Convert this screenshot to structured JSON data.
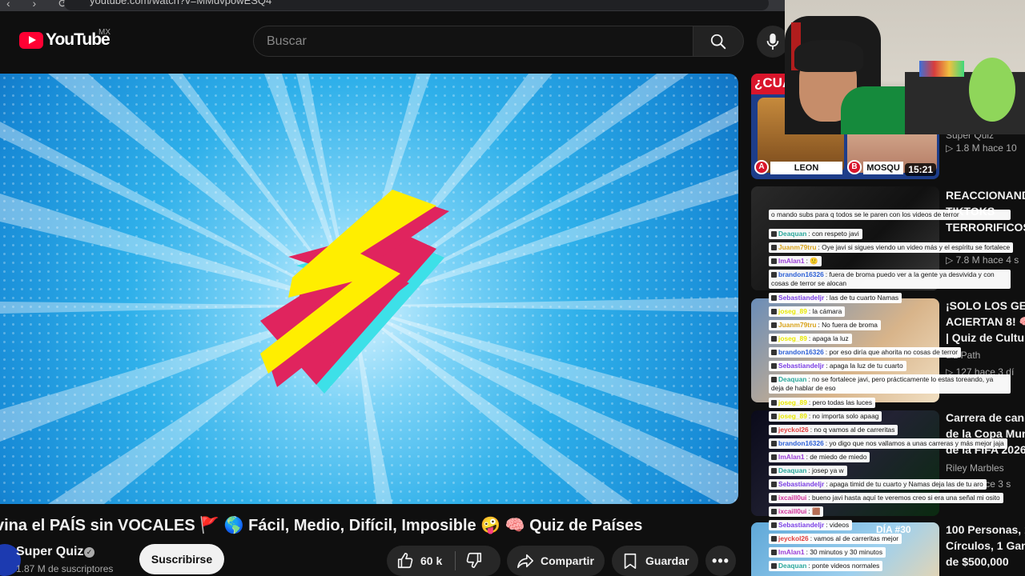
{
  "browser": {
    "url": "youtube.com/watch?v=MMdvpowESQ4",
    "nav_glyphs": "‹ › ⟳"
  },
  "header": {
    "logo_text": "YouTube",
    "country_code": "MX",
    "search_placeholder": "Buscar"
  },
  "video": {
    "title": "vina el PAÍS sin VOCALES 🚩 🌎 Fácil, Medio, Difícil, Imposible 🤪 🧠 Quiz de Países",
    "channel": "Super Quiz",
    "subscribers": "1.87 M de suscriptores",
    "subscribe_label": "Suscribirse",
    "likes": "60 k",
    "share_label": "Compartir",
    "save_label": "Guardar",
    "more_label": "•••"
  },
  "recommendations": [
    {
      "thumb_text": "¿CUA",
      "badge_a": "A",
      "label_a": "LEON",
      "badge_b": "B",
      "label_b": "MOSQU",
      "duration": "15:21",
      "title": "",
      "channel": "Super Quiz",
      "meta": "▷ 1.8 M  hace 10"
    },
    {
      "title": "REACCIONAND\nTIKTOKS\nTERRORIFICOS",
      "channel": "",
      "meta": "▷ 7.8 M  hace 4 s"
    },
    {
      "title": "¡SOLO LOS GEN\nACIERTAN 8! 🧠\n| Quiz de Cultura",
      "channel": "uiz Path",
      "meta": "▷ 127  hace 3 dí"
    },
    {
      "title": "Carrera de canic\nde la Copa Mund\nde la FIFA 2026",
      "channel": "Riley Marbles",
      "meta": "▷ 1 M  hace 3 s"
    },
    {
      "thumb_text": "DÍA #30",
      "title": "100 Personas, 1\nCírculos, 1 Gana\nde $500,000",
      "channel": "",
      "meta": ""
    }
  ],
  "chat": [
    {
      "user": "",
      "color": "#888888",
      "text": "o mando subs para q todos se le paren con los videos de terror",
      "wrap": true
    },
    {
      "user": "Deaquan",
      "color": "#2aa79b",
      "text": ": con respeto javi"
    },
    {
      "user": "Juanm79tru",
      "color": "#d8a21a",
      "text": ": Oye javi si sigues viendo un video más y el espíritu se fortalece"
    },
    {
      "user": "ImAlan1",
      "color": "#9b3fd6",
      "text": ": 🙂"
    },
    {
      "user": "brandon16326",
      "color": "#2b5fd6",
      "text": ": fuera de broma puedo ver a la gente ya desvivida y con cosas de terror se alocan",
      "wrap": true
    },
    {
      "user": "Sebastiandeljr",
      "color": "#7b3fe4",
      "text": ": las de tu cuarto Namas"
    },
    {
      "user": "joseg_89",
      "color": "#e8e800",
      "text": ": la cámara"
    },
    {
      "user": "Juanm79tru",
      "color": "#d8a21a",
      "text": ": No fuera de broma"
    },
    {
      "user": "joseg_89",
      "color": "#e8e800",
      "text": ": apaga la luz"
    },
    {
      "user": "brandon16326",
      "color": "#2b5fd6",
      "text": ": por eso diría que ahorita no cosas de terror"
    },
    {
      "user": "Sebastiandeljr",
      "color": "#7b3fe4",
      "text": ": apaga la luz de tu cuarto"
    },
    {
      "user": "Deaquan",
      "color": "#2aa79b",
      "text": ": no se fortalece javi, pero prácticamente lo estas toreando, ya deja de hablar de eso",
      "wrap": true
    },
    {
      "user": "joseg_89",
      "color": "#e8e800",
      "text": ": pero todas las luces"
    },
    {
      "user": "joseg_89",
      "color": "#e8e800",
      "text": ": no importa solo apaag"
    },
    {
      "user": "jeyckol26",
      "color": "#e03c3c",
      "text": ": no q vamos al de carreritas"
    },
    {
      "user": "brandon16326",
      "color": "#2b5fd6",
      "text": ": yo digo que nos vallamos a unas carreras y más mejor jaja"
    },
    {
      "user": "ImAlan1",
      "color": "#9b3fd6",
      "text": ": de miedo de miedo"
    },
    {
      "user": "Deaquan",
      "color": "#2aa79b",
      "text": ": josep ya w"
    },
    {
      "user": "Sebastiandeljr",
      "color": "#7b3fe4",
      "text": ": apaga timid de tu cuarto y Namas deja las de tu aro"
    },
    {
      "user": "ixcaill0ui",
      "color": "#d12f9a",
      "text": ": bueno javi hasta aquí te veremos creo si era una señal mi osito"
    },
    {
      "user": "ixcaill0ui",
      "color": "#d12f9a",
      "text": ": 🟫"
    },
    {
      "user": "Sebastiandeljr",
      "color": "#7b3fe4",
      "text": ": videos"
    },
    {
      "user": "jeyckol26",
      "color": "#e03c3c",
      "text": ": vamos al de carreritas mejor"
    },
    {
      "user": "ImAlan1",
      "color": "#9b3fd6",
      "text": ": 30 minutos y 30 minutos"
    },
    {
      "user": "Deaquan",
      "color": "#2aa79b",
      "text": ": ponte videos normales"
    }
  ],
  "colors": {
    "accent": "#ff0033",
    "bg": "#0f0f0f",
    "pill": "#272727",
    "bolt_yellow": "#ffee00",
    "bolt_pink": "#e0245e",
    "bolt_cyan": "#3de0e8"
  }
}
